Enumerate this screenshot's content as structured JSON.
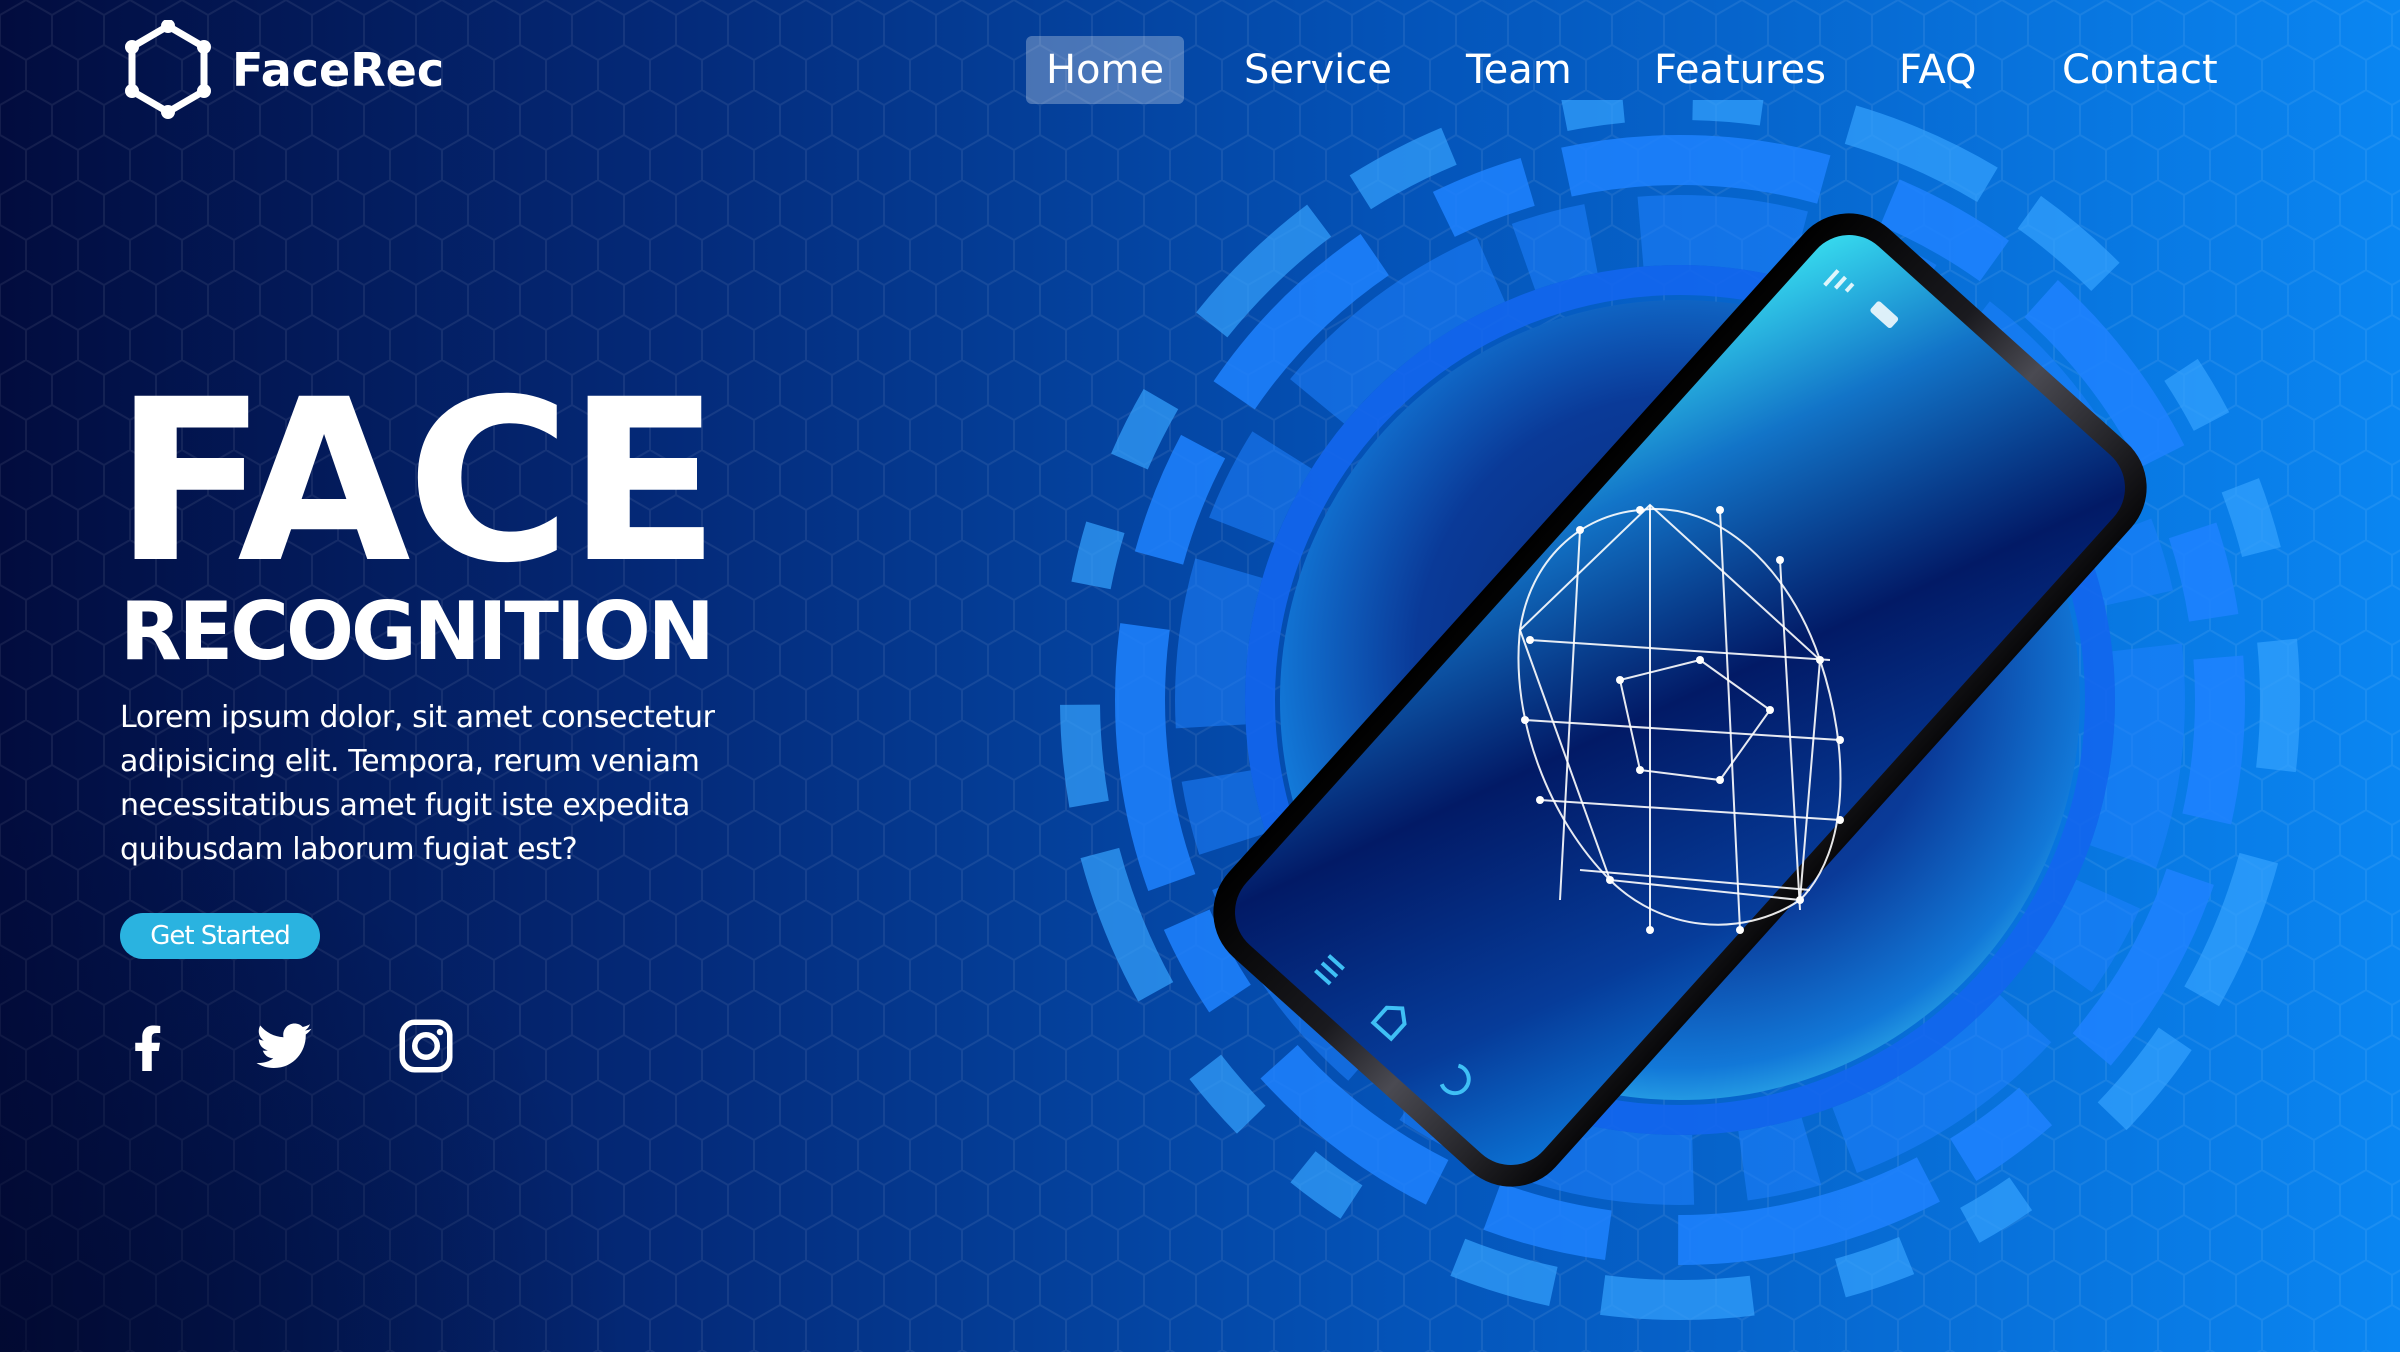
{
  "brand": {
    "name": "FaceRec",
    "logo_icon": "hexagon-network-icon"
  },
  "nav": {
    "items": [
      {
        "label": "Home",
        "active": true
      },
      {
        "label": "Service",
        "active": false
      },
      {
        "label": "Team",
        "active": false
      },
      {
        "label": "Features",
        "active": false
      },
      {
        "label": "FAQ",
        "active": false
      },
      {
        "label": "Contact",
        "active": false
      }
    ]
  },
  "hero": {
    "title": "FACE",
    "subtitle": "RECOGNITION",
    "description": "Lorem ipsum dolor, sit amet consectetur adipisicing elit. Tempora, rerum veniam necessitatibus amet fugit iste expedita quibusdam laborum fugiat est?",
    "cta_label": "Get Started"
  },
  "social": [
    {
      "icon": "facebook-icon"
    },
    {
      "icon": "twitter-icon"
    },
    {
      "icon": "instagram-icon"
    }
  ],
  "illustration": {
    "subject": "smartphone-face-scan",
    "icons": [
      "signal-icon",
      "battery-icon",
      "menu-icon",
      "home-icon",
      "back-icon"
    ]
  },
  "colors": {
    "bg_dark": "#020c3e",
    "bg_mid": "#0453b8",
    "bg_light": "#0a86f2",
    "accent": "#2ab3e0",
    "ring": "#1f82ff",
    "screen_glow": "#2ed2ec",
    "text": "#ffffff"
  }
}
